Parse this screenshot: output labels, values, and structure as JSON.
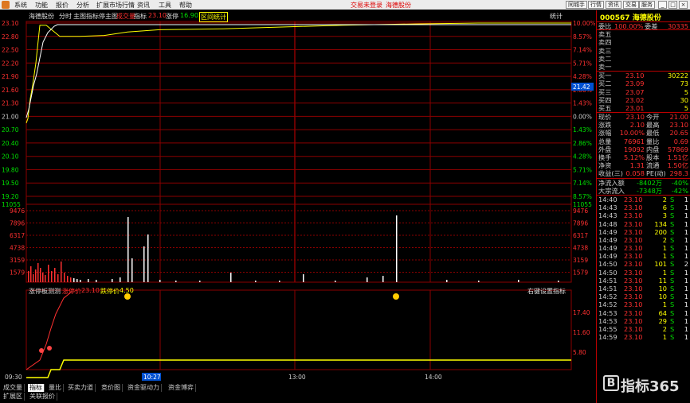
{
  "menu": {
    "items": [
      "系统",
      "功能",
      "报价",
      "分析",
      "扩展市场行情",
      "资讯",
      "工具",
      "帮助"
    ],
    "stock_tag_left": "交易未登录",
    "stock_tag_right": "海德股份",
    "right_buttons": [
      "同城手",
      "行情",
      "资讯",
      "交易",
      "服务"
    ],
    "window_buttons": [
      "_",
      "□",
      "×"
    ]
  },
  "chart_header": {
    "name": "海德股份",
    "mode": "分时",
    "indicators": "主图指标停主图",
    "avg_label": "成交量",
    "price_label": "指标",
    "price_value": "23.10",
    "change_label": "涨停",
    "change_value": "16.90",
    "zone_label": "区间统计",
    "stats_label": "统计"
  },
  "price_axis_left": [
    "23.10",
    "22.80",
    "22.50",
    "22.20",
    "21.90",
    "21.60",
    "21.30",
    "21.00",
    "20.70",
    "20.40",
    "20.10",
    "19.80",
    "19.50",
    "19.20"
  ],
  "pct_axis_right": [
    "10.00%",
    "8.57%",
    "7.14%",
    "5.71%",
    "4.28%",
    "2.86%",
    "1.43%",
    "0.00%",
    "1.43%",
    "2.86%",
    "4.28%",
    "5.71%",
    "7.14%",
    "8.57%"
  ],
  "axis_bottom_price": "11055",
  "cursor_price": "21.42",
  "volume_axis": [
    "9476",
    "7896",
    "6317",
    "4738",
    "3159",
    "1579"
  ],
  "indicator_panel": {
    "name": "涨停板测测",
    "label1": "涨停价",
    "value1": "23.10",
    "label2": "跌停价",
    "value2": "4.50",
    "right_note": "右键设置指标",
    "axis": [
      "17.40",
      "11.60",
      "5.80"
    ]
  },
  "time_axis": [
    "09:30",
    "10:27",
    "13:00",
    "14:00"
  ],
  "chart_data": {
    "type": "line",
    "title": "",
    "x": [
      "09:30",
      "09:33",
      "09:36",
      "09:39",
      "09:42",
      "09:45",
      "09:50",
      "10:00",
      "10:10",
      "10:20",
      "10:30",
      "11:00",
      "11:30",
      "13:00",
      "13:30",
      "14:00",
      "14:30",
      "15:00"
    ],
    "series": [
      {
        "values": [
          20.85,
          20.95,
          21.4,
          21.7,
          22.2,
          23.05,
          23.05,
          22.8,
          22.8,
          22.82,
          22.9,
          22.95,
          22.97,
          23.02,
          23.05,
          23.08,
          23.1,
          23.1
        ]
      }
    ],
    "ylim": [
      19.2,
      23.1
    ],
    "grid": true
  },
  "quote": {
    "code": "000567",
    "name": "海德股份",
    "weibi_label": "委比",
    "weibi_value": "100.00%",
    "weicha_label": "委差",
    "weicha_value": "30335",
    "sell": [
      {
        "label": "卖五",
        "price": "",
        "vol": ""
      },
      {
        "label": "卖四",
        "price": "",
        "vol": ""
      },
      {
        "label": "卖三",
        "price": "",
        "vol": ""
      },
      {
        "label": "卖二",
        "price": "",
        "vol": ""
      },
      {
        "label": "卖一",
        "price": "",
        "vol": ""
      }
    ],
    "buy": [
      {
        "label": "买一",
        "price": "23.10",
        "vol": "30222"
      },
      {
        "label": "买二",
        "price": "23.09",
        "vol": "73"
      },
      {
        "label": "买三",
        "price": "23.07",
        "vol": "5"
      },
      {
        "label": "买四",
        "price": "23.02",
        "vol": "30"
      },
      {
        "label": "买五",
        "price": "23.01",
        "vol": "5"
      }
    ],
    "stats": [
      {
        "l1": "现价",
        "v1": "23.10",
        "l2": "今开",
        "v2": "21.00"
      },
      {
        "l1": "涨跌",
        "v1": "2.10",
        "l2": "最高",
        "v2": "23.10"
      },
      {
        "l1": "涨幅",
        "v1": "10.00%",
        "l2": "最低",
        "v2": "20.65"
      },
      {
        "l1": "总量",
        "v1": "76961",
        "l2": "量比",
        "v2": "0.69"
      },
      {
        "l1": "外盘",
        "v1": "19092",
        "l2": "内盘",
        "v2": "57869"
      },
      {
        "l1": "换手",
        "v1": "5.12%",
        "l2": "股本",
        "v2": "1.51亿"
      },
      {
        "l1": "净资",
        "v1": "1.31",
        "l2": "流通",
        "v2": "1.50亿"
      },
      {
        "l1": "收益(三)",
        "v1": "0.058",
        "l2": "PE(动)",
        "v2": "298.3"
      }
    ],
    "flow": [
      {
        "label": "净流入额",
        "value": "-8402万",
        "pct": "-40%"
      },
      {
        "label": "大宗流入",
        "value": "-7348万",
        "pct": "-42%"
      }
    ],
    "ticks": [
      {
        "t": "14:40",
        "p": "23.10",
        "v": "2",
        "s": "S",
        "n": "1"
      },
      {
        "t": "14:43",
        "p": "23.10",
        "v": "6",
        "s": "S",
        "n": "1"
      },
      {
        "t": "14:43",
        "p": "23.10",
        "v": "3",
        "s": "S",
        "n": "1"
      },
      {
        "t": "14:48",
        "p": "23.10",
        "v": "134",
        "s": "S",
        "n": "1"
      },
      {
        "t": "14:49",
        "p": "23.10",
        "v": "200",
        "s": "S",
        "n": "1"
      },
      {
        "t": "14:49",
        "p": "23.10",
        "v": "2",
        "s": "S",
        "n": "1"
      },
      {
        "t": "14:49",
        "p": "23.10",
        "v": "1",
        "s": "S",
        "n": "1"
      },
      {
        "t": "14:49",
        "p": "23.10",
        "v": "1",
        "s": "S",
        "n": "1"
      },
      {
        "t": "14:50",
        "p": "23.10",
        "v": "101",
        "s": "S",
        "n": "2"
      },
      {
        "t": "14:50",
        "p": "23.10",
        "v": "1",
        "s": "S",
        "n": "1"
      },
      {
        "t": "14:51",
        "p": "23.10",
        "v": "11",
        "s": "S",
        "n": "1"
      },
      {
        "t": "14:51",
        "p": "23.10",
        "v": "10",
        "s": "S",
        "n": "1"
      },
      {
        "t": "14:52",
        "p": "23.10",
        "v": "10",
        "s": "S",
        "n": "1"
      },
      {
        "t": "14:52",
        "p": "23.10",
        "v": "1",
        "s": "S",
        "n": "1"
      },
      {
        "t": "14:53",
        "p": "23.10",
        "v": "64",
        "s": "S",
        "n": "1"
      },
      {
        "t": "14:53",
        "p": "23.10",
        "v": "29",
        "s": "S",
        "n": "1"
      },
      {
        "t": "14:55",
        "p": "23.10",
        "v": "2",
        "s": "S",
        "n": "1"
      },
      {
        "t": "14:59",
        "p": "23.10",
        "v": "1",
        "s": "S",
        "n": "1"
      }
    ]
  },
  "tabs_row1": [
    "成交量",
    "指标",
    "量比",
    "买卖力道",
    "竞价图",
    "资金驱动力",
    "资金博弈"
  ],
  "tabs_row2": [
    "扩展区",
    "关联报价"
  ],
  "right_tabs": [
    "笔",
    "价",
    "细",
    "势",
    "联",
    "值",
    "主",
    "筹"
  ],
  "watermark": "指标365",
  "colors": {
    "price_line": "#ffffff",
    "avg_line": "#ffff00",
    "grid": "#8b0000",
    "up": "#ff3030",
    "down": "#00e000"
  }
}
